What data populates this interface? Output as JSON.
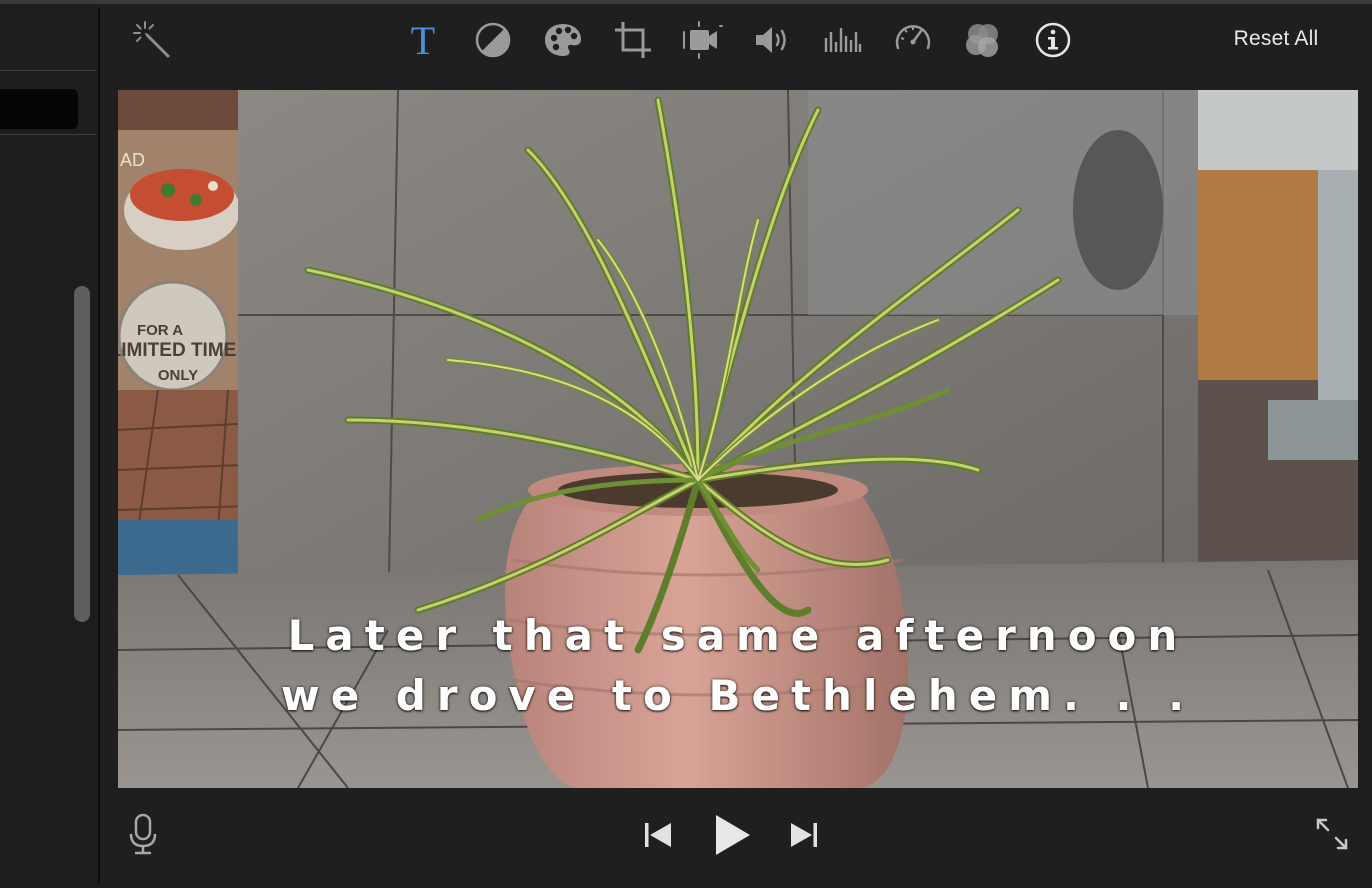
{
  "toolbar": {
    "tools": [
      {
        "id": "enhance",
        "icon": "magic-wand-icon"
      },
      {
        "id": "titles",
        "icon": "text-title-icon",
        "selected": true
      },
      {
        "id": "color-balance",
        "icon": "color-balance-icon"
      },
      {
        "id": "color-correction",
        "icon": "palette-icon"
      },
      {
        "id": "crop",
        "icon": "crop-icon"
      },
      {
        "id": "stabilization",
        "icon": "camera-stabilization-icon"
      },
      {
        "id": "volume",
        "icon": "speaker-icon"
      },
      {
        "id": "noise-reduction",
        "icon": "equalizer-icon"
      },
      {
        "id": "speed",
        "icon": "speedometer-icon"
      },
      {
        "id": "clip-filter",
        "icon": "clip-filter-icon"
      },
      {
        "id": "clip-info",
        "icon": "info-icon"
      }
    ],
    "reset_all_label": "Reset All"
  },
  "viewer": {
    "title_line1": "Later that same afternoon",
    "title_line2": "we drove to Bethlehem. . .",
    "poster_text_top": "AD",
    "poster_badge_line1": "FOR A",
    "poster_badge_line2": "LIMITED TIME",
    "poster_badge_line3": "ONLY"
  },
  "playback": {
    "controls": [
      {
        "id": "voiceover",
        "icon": "microphone-icon"
      },
      {
        "id": "previous",
        "icon": "skip-back-icon"
      },
      {
        "id": "play",
        "icon": "play-icon"
      },
      {
        "id": "next",
        "icon": "skip-forward-icon"
      },
      {
        "id": "fullscreen",
        "icon": "expand-icon"
      }
    ]
  },
  "colors": {
    "accent": "#4a90d9",
    "icon": "#9a9a9a",
    "background": "#1f1f1f"
  }
}
